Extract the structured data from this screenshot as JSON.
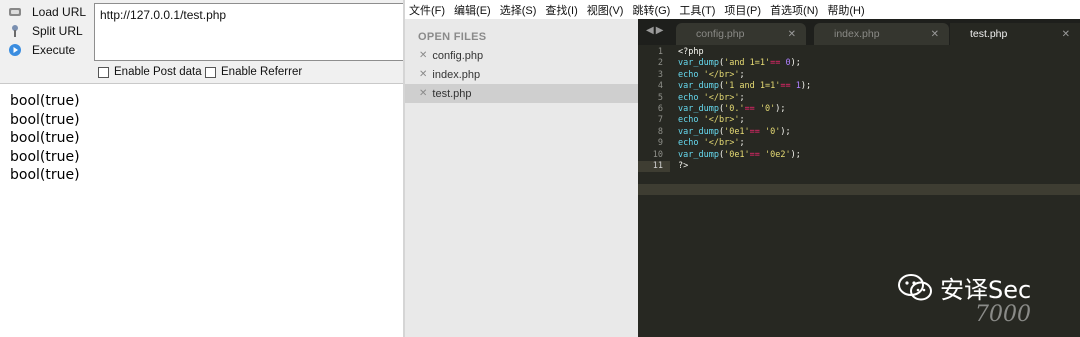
{
  "hackbar": {
    "buttons": [
      {
        "label": "Load URL",
        "icon": "load-url-icon"
      },
      {
        "label": "Split URL",
        "icon": "split-url-icon"
      },
      {
        "label": "Execute",
        "icon": "execute-icon"
      }
    ],
    "url_value": "http://127.0.0.1/test.php",
    "options": [
      {
        "label": "Enable Post data",
        "checked": false
      },
      {
        "label": "Enable Referrer",
        "checked": false
      }
    ]
  },
  "output_lines": [
    "bool(true)",
    "bool(true)",
    "bool(true)",
    "bool(true)",
    "bool(true)"
  ],
  "editor": {
    "menu": [
      "文件(F)",
      "编辑(E)",
      "选择(S)",
      "查找(I)",
      "视图(V)",
      "跳转(G)",
      "工具(T)",
      "项目(P)",
      "首选项(N)",
      "帮助(H)"
    ],
    "sidebar_title": "OPEN FILES",
    "open_files": [
      "config.php",
      "index.php",
      "test.php"
    ],
    "active_file": "test.php",
    "tabs": [
      "config.php",
      "index.php",
      "test.php"
    ],
    "line_numbers": [
      "1",
      "2",
      "3",
      "4",
      "5",
      "6",
      "7",
      "8",
      "9",
      "10",
      "11"
    ],
    "code_lines": [
      "<?php",
      "var_dump('and 1=1'== 0);",
      "echo '</br>';",
      "var_dump('1 and 1=1'== 1);",
      "echo '</br>';",
      "var_dump('0.'== '0');",
      "echo '</br>';",
      "var_dump('0e1'== '0');",
      "echo '</br>';",
      "var_dump('0e1'== '0e2');",
      "?>"
    ]
  },
  "watermark": {
    "text": "安译Sec",
    "subtext": "7000"
  },
  "colors": {
    "editor_bg": "#272822",
    "keyword": "#66d9ef",
    "string": "#e6db74",
    "operator": "#f92672",
    "number": "#ae81ff"
  }
}
